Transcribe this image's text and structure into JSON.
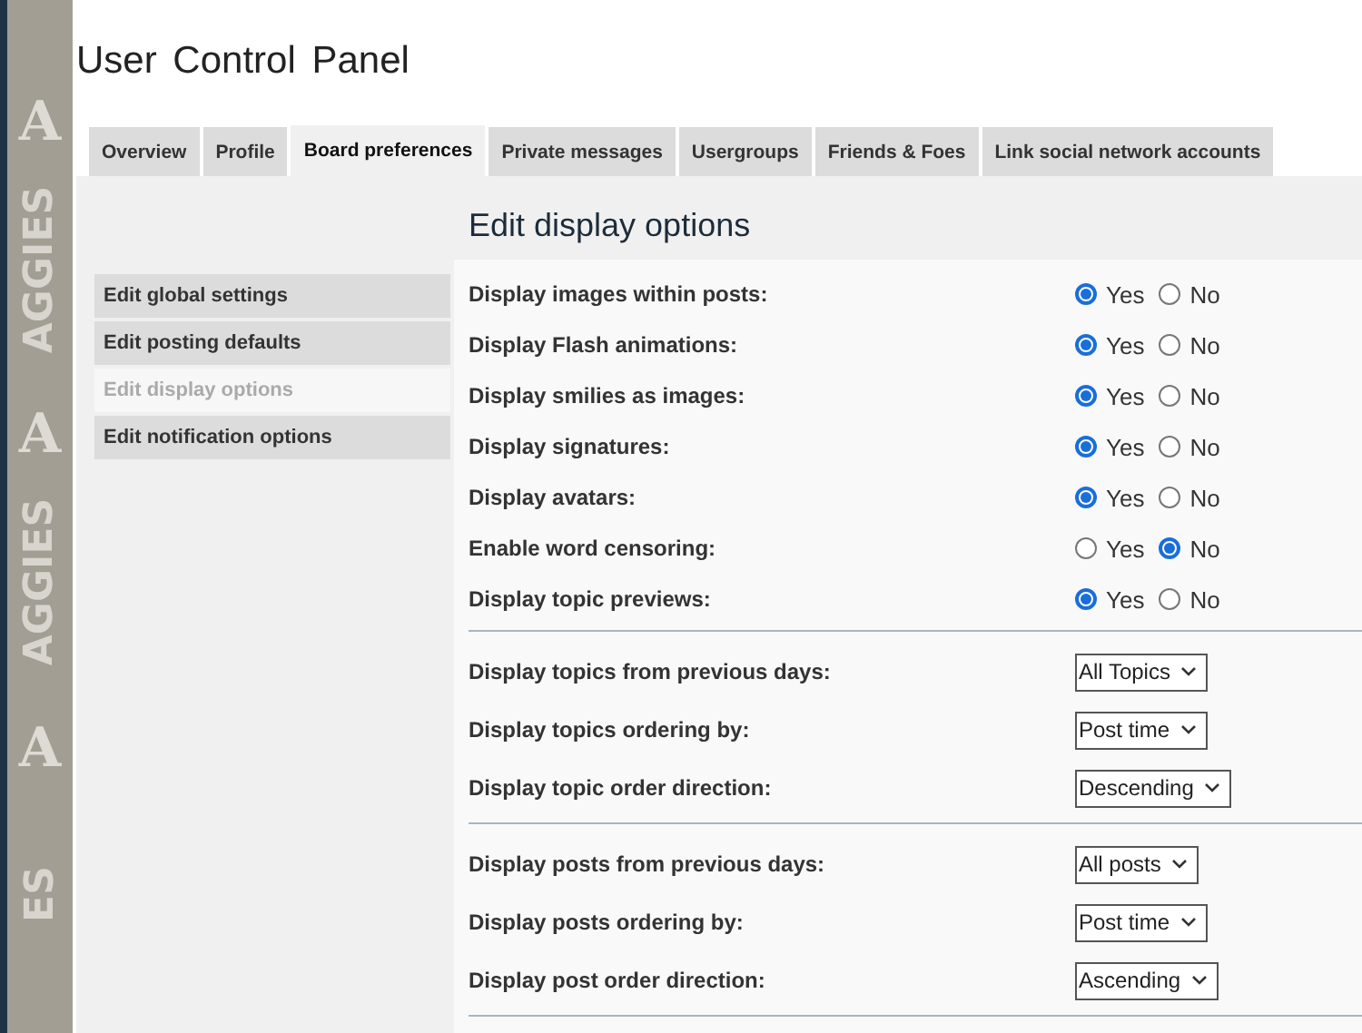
{
  "side_banner": [
    {
      "text": "A",
      "kind": "letter"
    },
    {
      "text": "AGGIES",
      "kind": "vertical"
    },
    {
      "text": "A",
      "kind": "letter"
    },
    {
      "text": "AGGIES",
      "kind": "vertical"
    },
    {
      "text": "A",
      "kind": "letter"
    },
    {
      "text": "ES",
      "kind": "vertical"
    }
  ],
  "page_title": "User Control Panel",
  "tabs": [
    {
      "label": "Overview",
      "selected": false
    },
    {
      "label": "Profile",
      "selected": false
    },
    {
      "label": "Board preferences",
      "selected": true
    },
    {
      "label": "Private messages",
      "selected": false
    },
    {
      "label": "Usergroups",
      "selected": false
    },
    {
      "label": "Friends & Foes",
      "selected": false
    },
    {
      "label": "Link social network accounts",
      "selected": false
    }
  ],
  "menu": [
    {
      "label": "Edit global settings",
      "selected": false
    },
    {
      "label": "Edit posting defaults",
      "selected": false
    },
    {
      "label": "Edit display options",
      "selected": true
    },
    {
      "label": "Edit notification options",
      "selected": false
    }
  ],
  "section_title": "Edit display options",
  "groups": [
    [
      {
        "kind": "radio",
        "label": "Display images within posts:",
        "options": [
          {
            "label": "Yes",
            "selected": true
          },
          {
            "label": "No",
            "selected": false
          }
        ]
      },
      {
        "kind": "radio",
        "label": "Display Flash animations:",
        "options": [
          {
            "label": "Yes",
            "selected": true
          },
          {
            "label": "No",
            "selected": false
          }
        ]
      },
      {
        "kind": "radio",
        "label": "Display smilies as images:",
        "options": [
          {
            "label": "Yes",
            "selected": true
          },
          {
            "label": "No",
            "selected": false
          }
        ]
      },
      {
        "kind": "radio",
        "label": "Display signatures:",
        "options": [
          {
            "label": "Yes",
            "selected": true
          },
          {
            "label": "No",
            "selected": false
          }
        ]
      },
      {
        "kind": "radio",
        "label": "Display avatars:",
        "options": [
          {
            "label": "Yes",
            "selected": true
          },
          {
            "label": "No",
            "selected": false
          }
        ]
      },
      {
        "kind": "radio",
        "label": "Enable word censoring:",
        "options": [
          {
            "label": "Yes",
            "selected": false
          },
          {
            "label": "No",
            "selected": true
          }
        ]
      },
      {
        "kind": "radio",
        "label": "Display topic previews:",
        "options": [
          {
            "label": "Yes",
            "selected": true
          },
          {
            "label": "No",
            "selected": false
          }
        ]
      }
    ],
    [
      {
        "kind": "select",
        "label": "Display topics from previous days:",
        "value": "All Topics"
      },
      {
        "kind": "select",
        "label": "Display topics ordering by:",
        "value": "Post time"
      },
      {
        "kind": "select",
        "label": "Display topic order direction:",
        "value": "Descending"
      }
    ],
    [
      {
        "kind": "select",
        "label": "Display posts from previous days:",
        "value": "All posts"
      },
      {
        "kind": "select",
        "label": "Display posts ordering by:",
        "value": "Post time"
      },
      {
        "kind": "select",
        "label": "Display post order direction:",
        "value": "Ascending"
      }
    ]
  ]
}
